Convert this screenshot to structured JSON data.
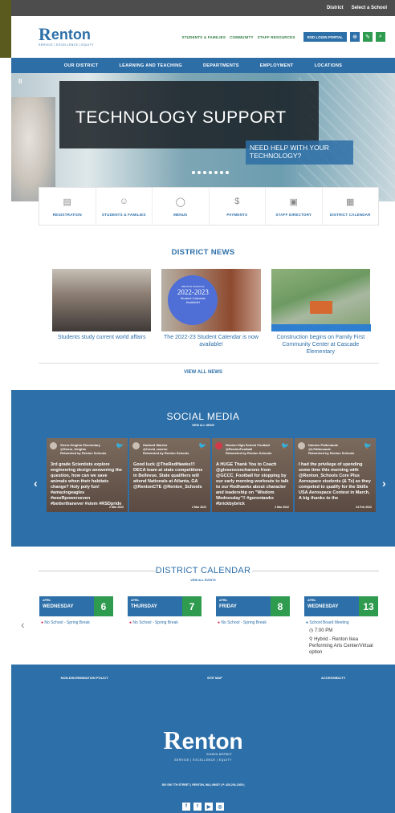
{
  "utility": {
    "district": "District",
    "translate": "Select a School"
  },
  "header": {
    "logo_name": "enton",
    "logo_letter": "R",
    "logo_sub": "SCHOOL DISTRICT",
    "logo_tagline": "SERVICE | EXCELLENCE | EQUITY",
    "links": [
      "STUDENTS & FAMILIES",
      "COMMUNITY",
      "STAFF RESOURCES"
    ],
    "login_label": "RSD LOGIN PORTAL"
  },
  "nav": [
    "OUR DISTRICT",
    "LEARNING AND TEACHING",
    "DEPARTMENTS",
    "EMPLOYMENT",
    "LOCATIONS"
  ],
  "hero": {
    "title": "TECHNOLOGY SUPPORT",
    "subtitle": "NEED HELP WITH YOUR TECHNOLOGY?",
    "pause": "II"
  },
  "quick_links": [
    {
      "label": "REGISTRATION",
      "icon": "registration-icon"
    },
    {
      "label": "STUDENTS & FAMILIES",
      "icon": "people-icon"
    },
    {
      "label": "MENUS",
      "icon": "apple-icon"
    },
    {
      "label": "PAYMENTS",
      "icon": "dollar-icon"
    },
    {
      "label": "STAFF DIRECTORY",
      "icon": "directory-icon"
    },
    {
      "label": "DISTRICT CALENDAR",
      "icon": "calendar-icon"
    }
  ],
  "news": {
    "title": "DISTRICT NEWS",
    "items": [
      {
        "caption": "Students study current world affairs"
      },
      {
        "caption": "The 2022-23 Student Calendar is now available!",
        "badge_top": "RENTON SCHOOLS",
        "badge_year": "2022-2023",
        "badge_text": "Student Calendar Available!"
      },
      {
        "caption": "Construction begins on Family First Community Center at Cascade Elementary"
      }
    ],
    "view_all": "VIEW ALL NEWS"
  },
  "social": {
    "title": "SOCIAL MEDIA",
    "view_all": "VIEW ALL NEWS",
    "posts": [
      {
        "author": "Sierra Heights Elementary",
        "handle": "@Sierra_Heights",
        "retweeted": "Retweeted by Renton Schools",
        "body": "3rd grade Scientists explore engineering design answering the question, how can we save animals when their habitats change? Holy poly fun! #amazingeagles #weeRpowerseven #betterthanever #stem #RSDpride",
        "date": "2 Mar 2022"
      },
      {
        "author": "Hazland Warrior",
        "handle": "@Covid_warrior",
        "retweeted": "Retweeted by Renton Schools",
        "body": "Good luck @TheRedHawks!!! DECA team at state competitions in Bellevue. State qualifiers will attend Nationals at Atlanta, GA @RentonCTE @Renton_Schools",
        "date": "2 Mar 2022"
      },
      {
        "author": "Renton High School Football",
        "handle": "@RentonFootball",
        "retweeted": "Retweeted by Renton Schools",
        "body": "A HUGE Thank You to Coach @glosenconcharons from @GCCC_Football for stopping by our early morning workouts to talk to our Redhawks about character and leadership on \"Wisdom Wednesday\"!! #gorentawks #brickbybrick",
        "date": "2 Mar 2022"
      },
      {
        "author": "Damien Pattenaude",
        "handle": "@LPattenaude",
        "retweeted": "Retweeted by Renton Schools",
        "body": "I had the privilege of spending some time this morning with @Renton_Schools Core Plus Aerospace students (& Ts) as they competed to qualify for the Skills USA Aerospace Contest in March. A big thanks to the",
        "date": "24 Feb 2022"
      }
    ]
  },
  "calendar": {
    "title": "DISTRICT CALENDAR",
    "view_all": "VIEW ALL EVENTS",
    "days": [
      {
        "month": "APRIL",
        "weekday": "WEDNESDAY",
        "num": "6",
        "event": "No School - Spring Break"
      },
      {
        "month": "APRIL",
        "weekday": "THURSDAY",
        "num": "7",
        "event": "No School - Spring Break"
      },
      {
        "month": "APRIL",
        "weekday": "FRIDAY",
        "num": "8",
        "event": "No School - Spring Break"
      },
      {
        "month": "APRIL",
        "weekday": "WEDNESDAY",
        "num": "13",
        "event": "School Board Meeting",
        "time": "7:00 PM",
        "location": "Hybrid - Renton Ikea Performing Arts Center/Virtual option"
      }
    ]
  },
  "footer": {
    "links": [
      "NON-DISCRIMINATION POLICY",
      "SITE MAP",
      "ACCESSIBILITY"
    ],
    "logo_name": "enton",
    "logo_letter": "R",
    "logo_sub": "SCHOOL DISTRICT",
    "tagline": "SERVICE | EXCELLENCE | EQUITY",
    "address": "300 SW 7TH STREET  |  RENTON, WA  |  98057  |  P. 425-204-2300  |"
  },
  "colors": {
    "brand_blue": "#2d6fa8",
    "accent_green": "#2e9b4f",
    "utility_bar": "#4d4d4d"
  }
}
